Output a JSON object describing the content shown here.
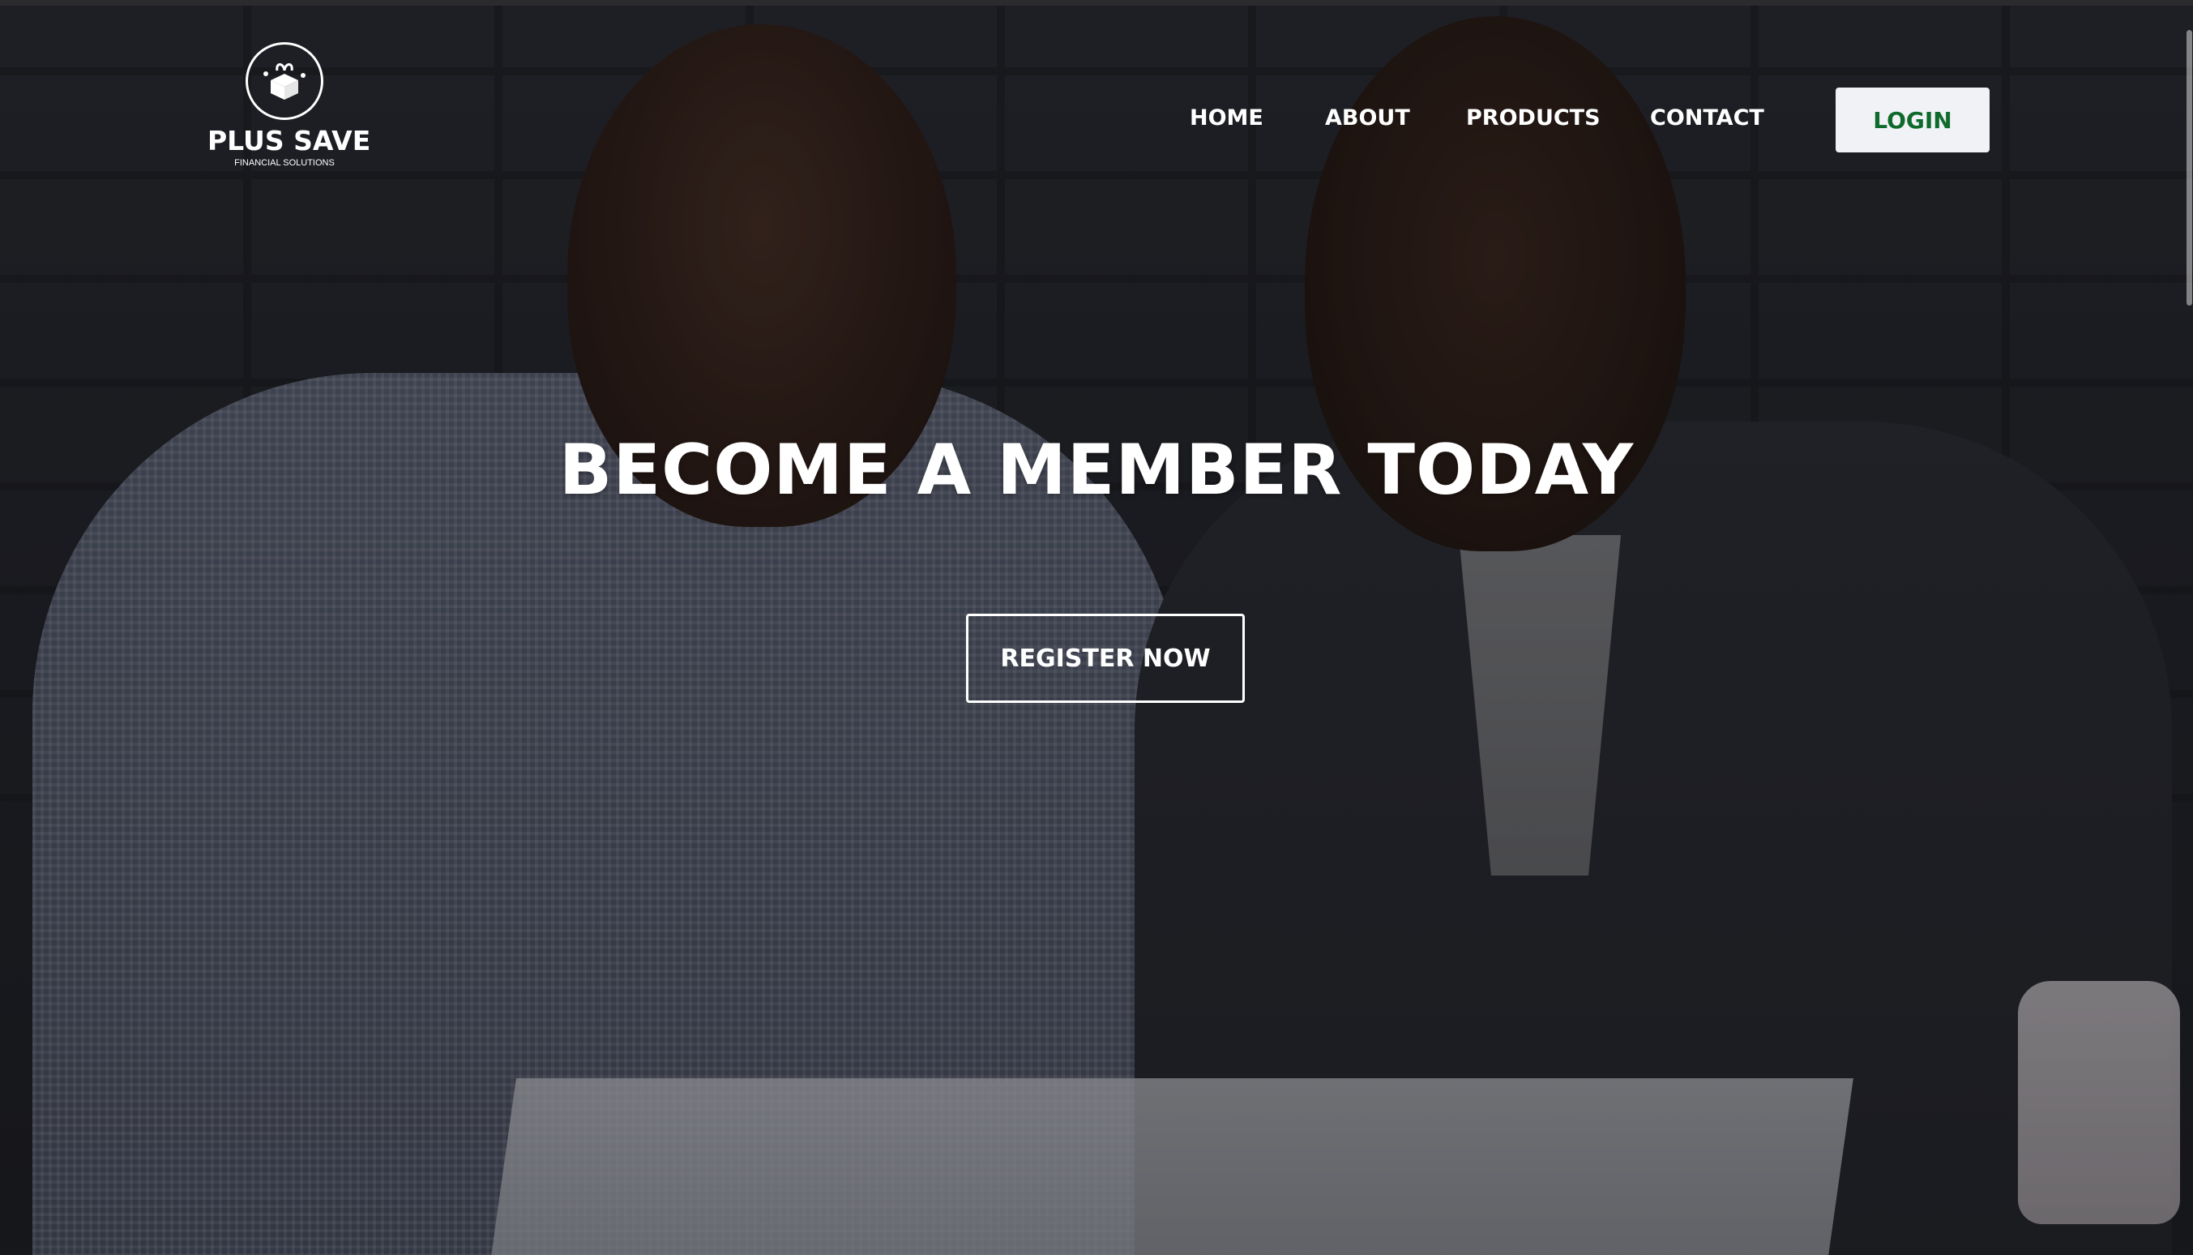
{
  "brand": {
    "name": "PLUS SAVE",
    "tagline": "FINANCIAL SOLUTIONS",
    "icon": "gift-box-icon"
  },
  "nav": {
    "items": [
      {
        "label": "HOME"
      },
      {
        "label": "ABOUT"
      },
      {
        "label": "PRODUCTS"
      },
      {
        "label": "CONTACT"
      }
    ],
    "login_label": "LOGIN"
  },
  "hero": {
    "title": "BECOME A MEMBER TODAY",
    "cta_label": "REGISTER NOW"
  },
  "colors": {
    "login_text": "#0f6b2c",
    "login_bg": "#f1f2f6",
    "text": "#ffffff"
  }
}
